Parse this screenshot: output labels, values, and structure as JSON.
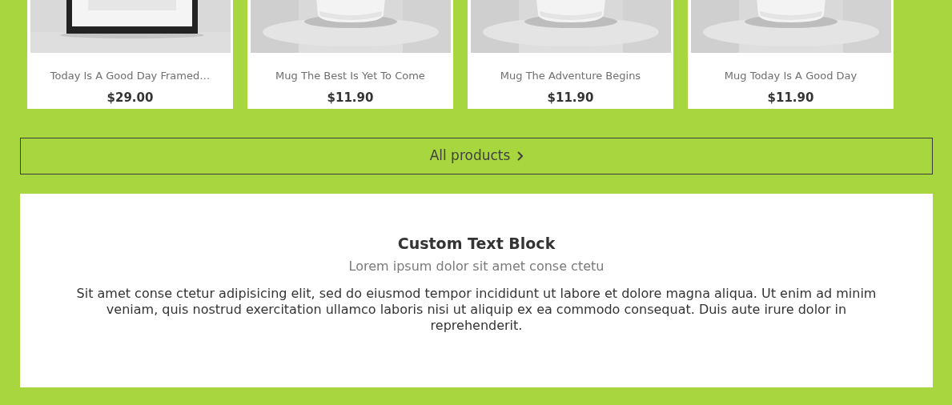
{
  "products": [
    {
      "kind": "frame",
      "name": "Today Is A Good Day Framed…",
      "price": "$29.00"
    },
    {
      "kind": "mug",
      "name": "Mug The Best Is Yet To Come",
      "price": "$11.90"
    },
    {
      "kind": "mug",
      "name": "Mug The Adventure Begins",
      "price": "$11.90"
    },
    {
      "kind": "mug",
      "name": "Mug Today Is A Good Day",
      "price": "$11.90"
    }
  ],
  "all_products_button": {
    "label": "All products"
  },
  "text_block": {
    "title": "Custom Text Block",
    "subtitle": "Lorem ipsum dolor sit amet conse ctetu",
    "body": "Sit amet conse ctetur adipisicing elit, sed do eiusmod tempor incididunt ut labore et dolore magna aliqua. Ut enim ad minim veniam, quis nostrud exercitation ullamco laboris nisi ut aliquip ex ea commodo consequat. Duis aute irure dolor in reprehenderit."
  }
}
